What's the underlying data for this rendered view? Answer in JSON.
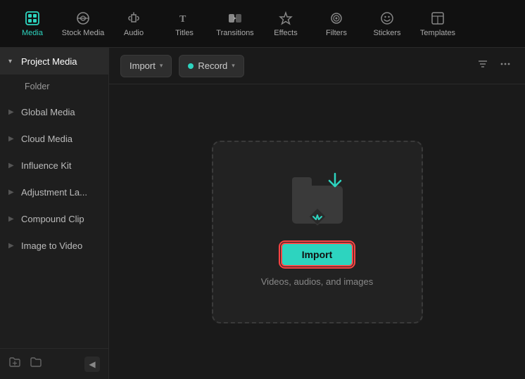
{
  "topnav": {
    "items": [
      {
        "id": "media",
        "label": "Media",
        "icon": "media",
        "active": true
      },
      {
        "id": "stock-media",
        "label": "Stock Media",
        "icon": "stock"
      },
      {
        "id": "audio",
        "label": "Audio",
        "icon": "audio"
      },
      {
        "id": "titles",
        "label": "Titles",
        "icon": "titles"
      },
      {
        "id": "transitions",
        "label": "Transitions",
        "icon": "transitions"
      },
      {
        "id": "effects",
        "label": "Effects",
        "icon": "effects"
      },
      {
        "id": "filters",
        "label": "Filters",
        "icon": "filters"
      },
      {
        "id": "stickers",
        "label": "Stickers",
        "icon": "stickers"
      },
      {
        "id": "templates",
        "label": "Templates",
        "icon": "templates"
      }
    ]
  },
  "sidebar": {
    "items": [
      {
        "id": "project-media",
        "label": "Project Media",
        "active": true,
        "expanded": true
      },
      {
        "id": "folder",
        "label": "Folder",
        "sub": true
      },
      {
        "id": "global-media",
        "label": "Global Media",
        "active": false
      },
      {
        "id": "cloud-media",
        "label": "Cloud Media"
      },
      {
        "id": "influence-kit",
        "label": "Influence Kit"
      },
      {
        "id": "adjustment-la",
        "label": "Adjustment La..."
      },
      {
        "id": "compound-clip",
        "label": "Compound Clip"
      },
      {
        "id": "image-to-video",
        "label": "Image to Video"
      }
    ],
    "footer": {
      "new_folder_icon": "new-folder",
      "folder_icon": "folder",
      "collapse_icon": "◀"
    }
  },
  "toolbar": {
    "import_label": "Import",
    "record_label": "Record",
    "filter_icon": "filter",
    "more_icon": "more"
  },
  "dropzone": {
    "import_button": "Import",
    "description": "Videos, audios, and images"
  }
}
